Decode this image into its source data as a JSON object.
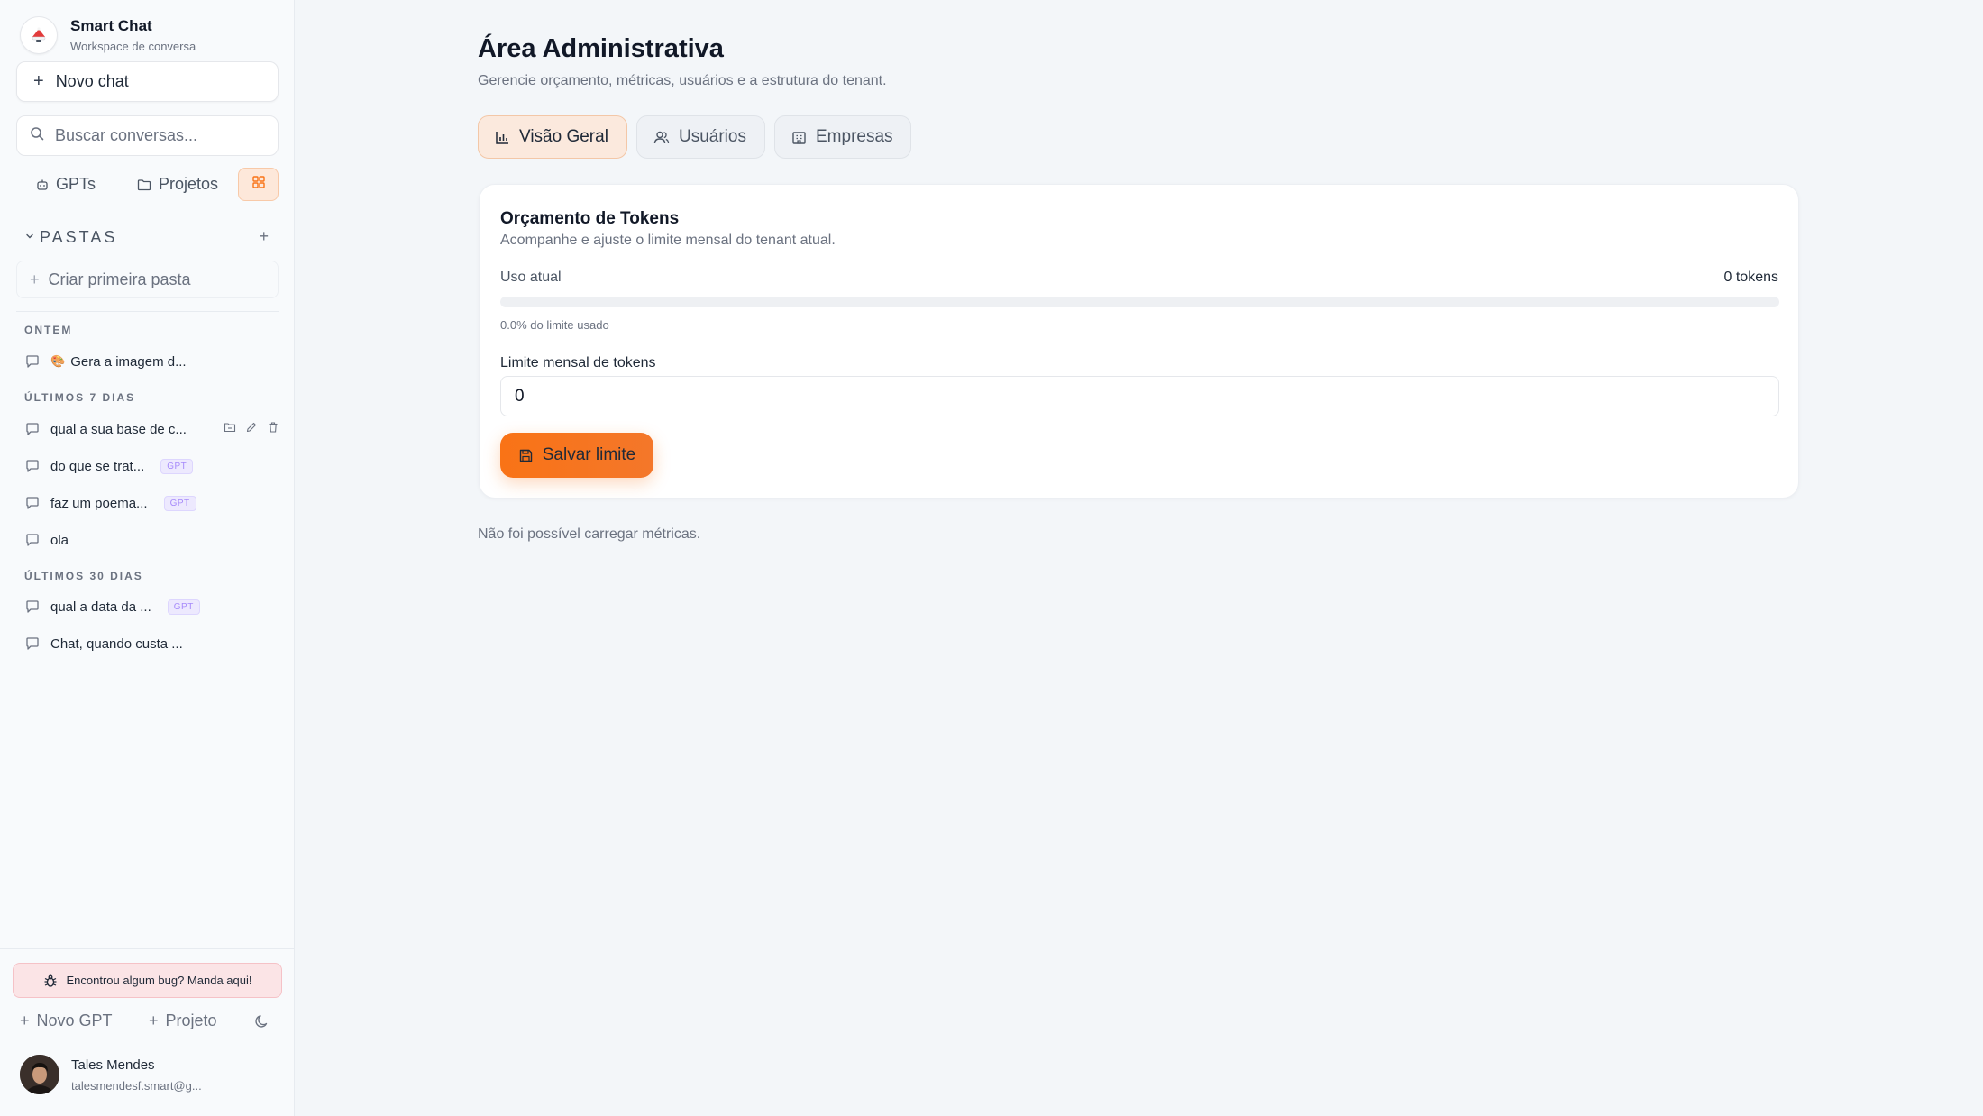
{
  "sidebar": {
    "brand_title": "Smart Chat",
    "brand_sub": "Workspace de conversa",
    "new_chat_label": "Novo chat",
    "search_placeholder": "Buscar conversas...",
    "gpts_label": "GPTs",
    "projects_label": "Projetos",
    "folders_title": "PASTAS",
    "create_folder_label": "Criar primeira pasta",
    "groups": [
      {
        "label": "ONTEM",
        "items": [
          {
            "emoji": "🎨",
            "title": "Gera a imagem d...",
            "badge": ""
          }
        ]
      },
      {
        "label": "ÚLTIMOS 7 DIAS",
        "items": [
          {
            "title": "qual a sua base de c...",
            "badge": ""
          },
          {
            "title": "do que se trat...",
            "badge": "GPT"
          },
          {
            "title": "faz um poema...",
            "badge": "GPT"
          },
          {
            "title": "ola",
            "badge": ""
          }
        ]
      },
      {
        "label": "ÚLTIMOS 30 DIAS",
        "items": [
          {
            "title": "qual a data da ...",
            "badge": "GPT"
          },
          {
            "title": "Chat, quando custa ...",
            "badge": ""
          }
        ]
      }
    ],
    "bug_label": "Encontrou algum bug? Manda aqui!",
    "new_gpt_label": "Novo GPT",
    "new_project_label": "Projeto",
    "user_name": "Tales Mendes",
    "user_email": "talesmendesf.smart@g..."
  },
  "main": {
    "title": "Área Administrativa",
    "subtitle": "Gerencie orçamento, métricas, usuários e a estrutura do tenant.",
    "tabs": [
      {
        "label": "Visão Geral",
        "active": true
      },
      {
        "label": "Usuários",
        "active": false
      },
      {
        "label": "Empresas",
        "active": false
      }
    ],
    "budget": {
      "title": "Orçamento de Tokens",
      "subtitle": "Acompanhe e ajuste o limite mensal do tenant atual.",
      "usage_label": "Uso atual",
      "usage_value": "0 tokens",
      "usage_fraction": 0.0,
      "usage_note": "0.0% do limite usado",
      "limit_label": "Limite mensal de tokens",
      "limit_value": "0",
      "save_label": "Salvar limite"
    },
    "metrics_error": "Não foi possível carregar métricas."
  },
  "colors": {
    "accent": "#f97316",
    "accent_soft": "#fbe9dd",
    "bug_bg": "#fbe4e6",
    "gpt_badge": "#a78bfa"
  }
}
